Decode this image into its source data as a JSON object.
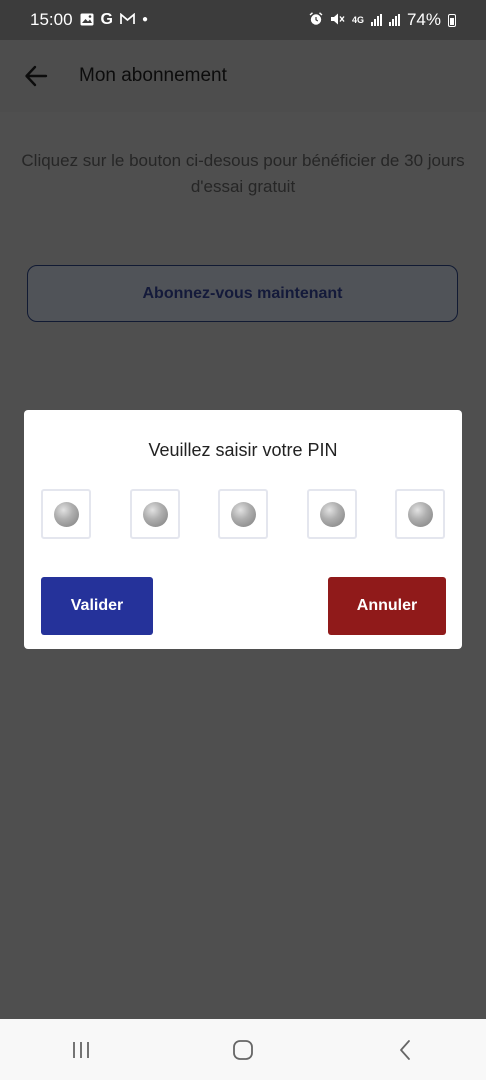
{
  "status_bar": {
    "time": "15:00",
    "network_type": "4G",
    "battery": "74%",
    "icons": [
      "gallery-icon",
      "google-icon",
      "gmail-icon",
      "dot-icon",
      "alarm-icon",
      "mute-icon",
      "network-4g-icon",
      "signal-icon",
      "signal-icon",
      "battery-icon"
    ]
  },
  "app_bar": {
    "back_icon": "back-arrow-icon",
    "title": "Mon abonnement"
  },
  "content": {
    "intro_text": "Cliquez sur le bouton ci-desous pour bénéficier de 30 jours d'essai gratuit",
    "subscribe_button": "Abonnez-vous maintenant"
  },
  "dialog": {
    "title": "Veuillez saisir votre PIN",
    "pin_length": 5,
    "validate_label": "Valider",
    "cancel_label": "Annuler",
    "colors": {
      "validate": "#25329a",
      "cancel": "#901a1a"
    }
  },
  "nav_bar": {
    "items": [
      "recent-apps-icon",
      "home-icon",
      "back-icon"
    ]
  },
  "colors": {
    "overlay": "#4f4f4f",
    "status_bar": "#3c3c3c"
  }
}
